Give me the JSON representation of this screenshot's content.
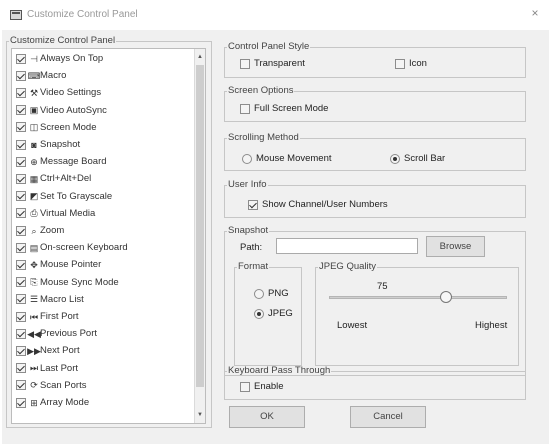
{
  "window": {
    "title": "Customize Control Panel",
    "close_glyph": "×"
  },
  "left_panel": {
    "legend": "Customize Control Panel",
    "items": [
      {
        "label": "Always On Top",
        "icon": "pin-icon",
        "glyph": "⊣",
        "checked": true
      },
      {
        "label": "Macro",
        "icon": "macro-icon",
        "glyph": "⌨",
        "checked": true
      },
      {
        "label": "Video Settings",
        "icon": "wrench-icon",
        "glyph": "⚒",
        "checked": true
      },
      {
        "label": "Video AutoSync",
        "icon": "autosync-icon",
        "glyph": "▣",
        "checked": true
      },
      {
        "label": "Screen Mode",
        "icon": "screen-mode-icon",
        "glyph": "◫",
        "checked": true
      },
      {
        "label": "Snapshot",
        "icon": "camera-icon",
        "glyph": "◙",
        "checked": true
      },
      {
        "label": "Message Board",
        "icon": "message-board-icon",
        "glyph": "⊕",
        "checked": true
      },
      {
        "label": "Ctrl+Alt+Del",
        "icon": "keyboard-keys-icon",
        "glyph": "▦",
        "checked": true
      },
      {
        "label": "Set To Grayscale",
        "icon": "grayscale-icon",
        "glyph": "◩",
        "checked": true
      },
      {
        "label": "Virtual Media",
        "icon": "virtual-media-icon",
        "glyph": "⎙",
        "checked": true
      },
      {
        "label": "Zoom",
        "icon": "zoom-icon",
        "glyph": "⌕",
        "checked": true
      },
      {
        "label": "On-screen Keyboard",
        "icon": "onscreen-keyboard-icon",
        "glyph": "▤",
        "checked": true
      },
      {
        "label": "Mouse Pointer",
        "icon": "mouse-pointer-icon",
        "glyph": "✥",
        "checked": true
      },
      {
        "label": "Mouse Sync Mode",
        "icon": "mouse-sync-icon",
        "glyph": "⎘",
        "checked": true
      },
      {
        "label": "Macro List",
        "icon": "macro-list-icon",
        "glyph": "☰",
        "checked": true
      },
      {
        "label": "First Port",
        "icon": "first-port-icon",
        "glyph": "⏮",
        "checked": true
      },
      {
        "label": "Previous Port",
        "icon": "previous-port-icon",
        "glyph": "◀◀",
        "checked": true
      },
      {
        "label": "Next Port",
        "icon": "next-port-icon",
        "glyph": "▶▶",
        "checked": true
      },
      {
        "label": "Last Port",
        "icon": "last-port-icon",
        "glyph": "⏭",
        "checked": true
      },
      {
        "label": "Scan Ports",
        "icon": "scan-ports-icon",
        "glyph": "⟳",
        "checked": true
      },
      {
        "label": "Array Mode",
        "icon": "array-mode-icon",
        "glyph": "⊞",
        "checked": true
      }
    ]
  },
  "control_panel_style": {
    "legend": "Control Panel Style",
    "transparent_label": "Transparent",
    "transparent_checked": false,
    "icon_label": "Icon",
    "icon_checked": false
  },
  "screen_options": {
    "legend": "Screen Options",
    "full_screen_label": "Full Screen Mode",
    "full_screen_checked": false
  },
  "scrolling_method": {
    "legend": "Scrolling Method",
    "mouse_movement_label": "Mouse Movement",
    "scroll_bar_label": "Scroll Bar",
    "selected": "Scroll Bar"
  },
  "user_info": {
    "legend": "User Info",
    "show_label": "Show Channel/User Numbers",
    "show_checked": true
  },
  "snapshot": {
    "legend": "Snapshot",
    "path_label": "Path:",
    "path_value": "",
    "browse_label": "Browse",
    "format": {
      "legend": "Format",
      "png_label": "PNG",
      "jpeg_label": "JPEG",
      "selected": "JPEG"
    },
    "jpeg_quality": {
      "legend": "JPEG Quality",
      "value": "75",
      "value_fraction": 0.66,
      "lowest_label": "Lowest",
      "highest_label": "Highest"
    }
  },
  "keyboard_pass_through": {
    "legend": "Keyboard Pass Through",
    "enable_label": "Enable",
    "enable_checked": false
  },
  "buttons": {
    "ok": "OK",
    "cancel": "Cancel"
  }
}
